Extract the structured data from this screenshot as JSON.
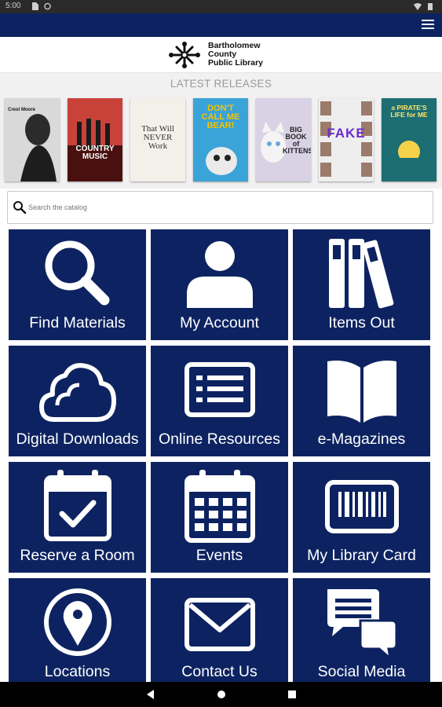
{
  "status_bar": {
    "time": "5:00"
  },
  "header": {
    "menu_icon": "hamburger-menu-icon"
  },
  "logo": {
    "line1": "Bartholomew",
    "line2": "County",
    "line3": "Public Library"
  },
  "releases": {
    "title": "LATEST RELEASES",
    "books": [
      {
        "cover_text": "Crest Moore",
        "bg": "#d9d9d9"
      },
      {
        "cover_text": "COUNTRY MUSIC",
        "bg": "#7a1c1c"
      },
      {
        "cover_text": "That Will NEVER Work",
        "bg": "#f3f0ea"
      },
      {
        "cover_text": "DON'T CALL ME BEAR!",
        "bg": "#3aa3d8"
      },
      {
        "cover_text": "BIG BOOK of KITTENS",
        "bg": "#d8d2e4"
      },
      {
        "cover_text": "FAKE",
        "bg": "#eeeeee"
      },
      {
        "cover_text": "a PIRATE'S LIFE for ME",
        "bg": "#1d6e72"
      }
    ]
  },
  "search": {
    "placeholder": "Search the catalog"
  },
  "tiles": [
    {
      "label": "Find Materials",
      "icon": "magnifier-icon"
    },
    {
      "label": "My Account",
      "icon": "person-icon"
    },
    {
      "label": "Items Out",
      "icon": "books-icon"
    },
    {
      "label": "Digital Downloads",
      "icon": "cloud-icon"
    },
    {
      "label": "Online Resources",
      "icon": "list-window-icon"
    },
    {
      "label": "e-Magazines",
      "icon": "open-book-icon"
    },
    {
      "label": "Reserve a Room",
      "icon": "calendar-check-icon"
    },
    {
      "label": "Events",
      "icon": "calendar-grid-icon"
    },
    {
      "label": "My Library Card",
      "icon": "barcode-card-icon"
    },
    {
      "label": "Locations",
      "icon": "map-pin-icon"
    },
    {
      "label": "Contact Us",
      "icon": "envelope-icon"
    },
    {
      "label": "Social Media",
      "icon": "chat-bubbles-icon"
    }
  ],
  "colors": {
    "brand_navy": "#0d2361",
    "releases_bg": "#f1f1f1"
  },
  "nav_bar": {
    "back_icon": "back-triangle-icon",
    "home_icon": "home-circle-icon",
    "recents_icon": "recents-square-icon"
  }
}
